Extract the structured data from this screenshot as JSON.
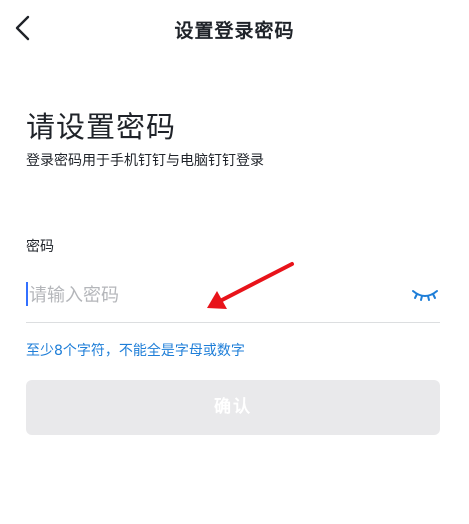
{
  "nav": {
    "title": "设置登录密码",
    "back_icon": "chevron-left-icon"
  },
  "header": {
    "heading": "请设置密码",
    "subtitle": "登录密码用于手机钉钉与电脑钉钉登录"
  },
  "password_field": {
    "label": "密码",
    "value": "",
    "placeholder": "请输入密码",
    "toggle_icon": "eye-closed-icon"
  },
  "hint": "至少8个字符，不能全是字母或数字",
  "confirm_label": "确认",
  "colors": {
    "accent": "#1e7ed8",
    "caret": "#3370ff",
    "button_disabled_bg": "#e9e9eb",
    "annotation_arrow": "#e8131a"
  }
}
